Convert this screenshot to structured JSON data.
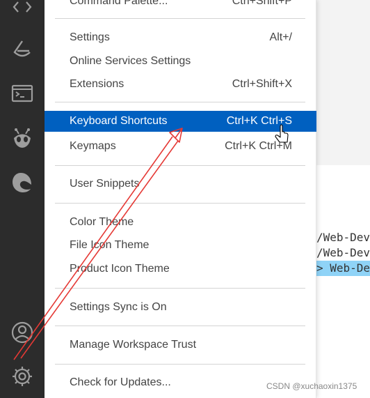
{
  "menu": {
    "items": [
      {
        "label": "Command Palette...",
        "shortcut": "Ctrl+Shift+P"
      },
      {
        "label": "Settings",
        "shortcut": "Alt+/"
      },
      {
        "label": "Online Services Settings",
        "shortcut": ""
      },
      {
        "label": "Extensions",
        "shortcut": "Ctrl+Shift+X"
      },
      {
        "label": "Keyboard Shortcuts",
        "shortcut": "Ctrl+K Ctrl+S"
      },
      {
        "label": "Keymaps",
        "shortcut": "Ctrl+K Ctrl+M"
      },
      {
        "label": "User Snippets",
        "shortcut": ""
      },
      {
        "label": "Color Theme",
        "shortcut": ""
      },
      {
        "label": "File Icon Theme",
        "shortcut": ""
      },
      {
        "label": "Product Icon Theme",
        "shortcut": ""
      },
      {
        "label": "Settings Sync is On",
        "shortcut": ""
      },
      {
        "label": "Manage Workspace Trust",
        "shortcut": ""
      },
      {
        "label": "Check for Updates...",
        "shortcut": ""
      }
    ],
    "active_label": "Keyboard Shortcuts"
  },
  "terminal": {
    "lines": [
      "/Web-Dev",
      "/Web-Dev",
      "> Web-Dev"
    ]
  },
  "activity_bar": {
    "icons": [
      "source-control-icon",
      "git-lens-icon",
      "terminal-icon",
      "alien-extension-icon",
      "edge-icon",
      "account-icon",
      "settings-gear-icon"
    ]
  },
  "watermark": "CSDN @xuchaoxin1375",
  "colors": {
    "activity_bar_bg": "#2c2c2c",
    "menu_selection": "#0060c0",
    "annotation_arrow": "#e53935",
    "terminal_highlight": "#8fd3f7"
  }
}
